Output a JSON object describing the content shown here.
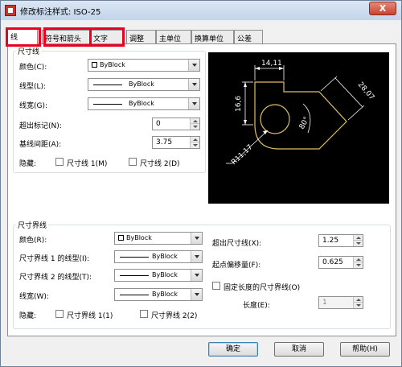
{
  "window": {
    "title": "修改标注样式: ISO-25",
    "close": "X"
  },
  "tabs": [
    {
      "label": "线"
    },
    {
      "label": "符号和箭头"
    },
    {
      "label": "文字"
    },
    {
      "label": "调整"
    },
    {
      "label": "主单位"
    },
    {
      "label": "换算单位"
    },
    {
      "label": "公差"
    }
  ],
  "dim_lines": {
    "title": "尺寸线",
    "color_label": "颜色(C):",
    "color_value": "ByBlock",
    "linetype_label": "线型(L):",
    "linetype_value": "ByBlock",
    "lineweight_label": "线宽(G):",
    "lineweight_value": "ByBlock",
    "extend_label": "超出标记(N):",
    "extend_value": "0",
    "baseline_label": "基线间距(A):",
    "baseline_value": "3.75",
    "suppress_label": "隐藏:",
    "suppress1": "尺寸线 1(M)",
    "suppress2": "尺寸线 2(D)"
  },
  "ext_lines": {
    "title": "尺寸界线",
    "color_label": "颜色(R):",
    "color_value": "ByBlock",
    "lt1_label": "尺寸界线 1 的线型(I):",
    "lt1_value": "ByBlock",
    "lt2_label": "尺寸界线 2 的线型(T):",
    "lt2_value": "ByBlock",
    "lw_label": "线宽(W):",
    "lw_value": "ByBlock",
    "suppress_label": "隐藏:",
    "suppress1": "尺寸界线 1(1)",
    "suppress2": "尺寸界线 2(2)",
    "beyond_label": "超出尺寸线(X):",
    "beyond_value": "1.25",
    "offset_label": "起点偏移量(F):",
    "offset_value": "0.625",
    "fixed_label": "固定长度的尺寸界线(O)",
    "length_label": "长度(E):",
    "length_value": "1"
  },
  "preview": {
    "dim_top": "14,11",
    "dim_left": "16,6",
    "dim_right": "28,07",
    "dim_angle": "80°",
    "dim_radius": "R11,17"
  },
  "buttons": {
    "ok": "确定",
    "cancel": "取消",
    "help": "帮助(H)"
  },
  "colors": {
    "highlight": "#e8001e",
    "drawing": "#e0c060"
  }
}
